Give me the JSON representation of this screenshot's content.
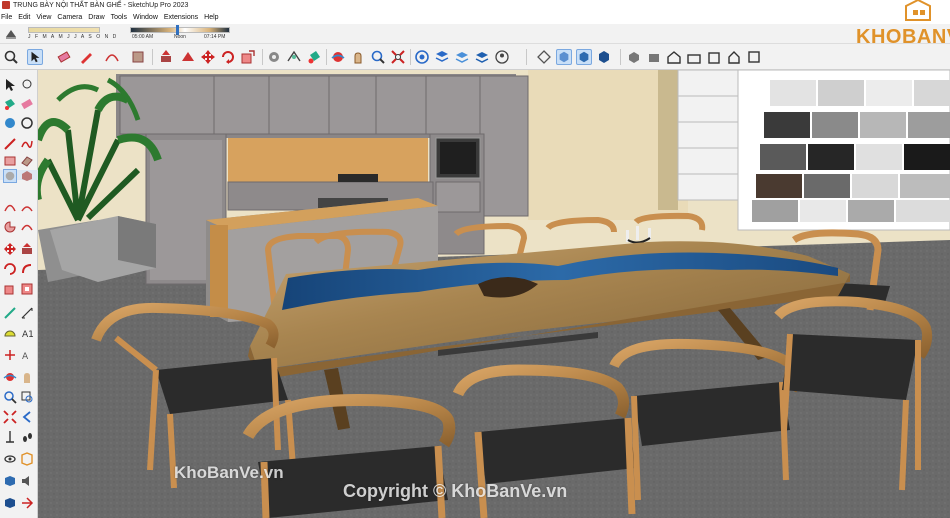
{
  "window": {
    "title": "TRUNG BÀY NỘI THẤT BÀN GHẾ - SketchUp Pro 2023"
  },
  "menu": [
    "File",
    "Edit",
    "View",
    "Camera",
    "Draw",
    "Tools",
    "Window",
    "Extensions",
    "Help"
  ],
  "shadows": {
    "months": "J F M A M J J A S O N D",
    "time_start": "05:00 AM",
    "time_noon": "Noon",
    "time_end": "07:14 PM"
  },
  "logo": {
    "text": "KHOBANVE"
  },
  "watermarks": {
    "left": "KhoBanVe.vn",
    "center": "Copyright © KhoBanVe.vn"
  },
  "colors": {
    "logo": "#e0922a",
    "table_resin": "#1e4f8c",
    "wood": "#c98f4f",
    "seat": "#2a2a2a",
    "floor": "#6b6b6b"
  }
}
